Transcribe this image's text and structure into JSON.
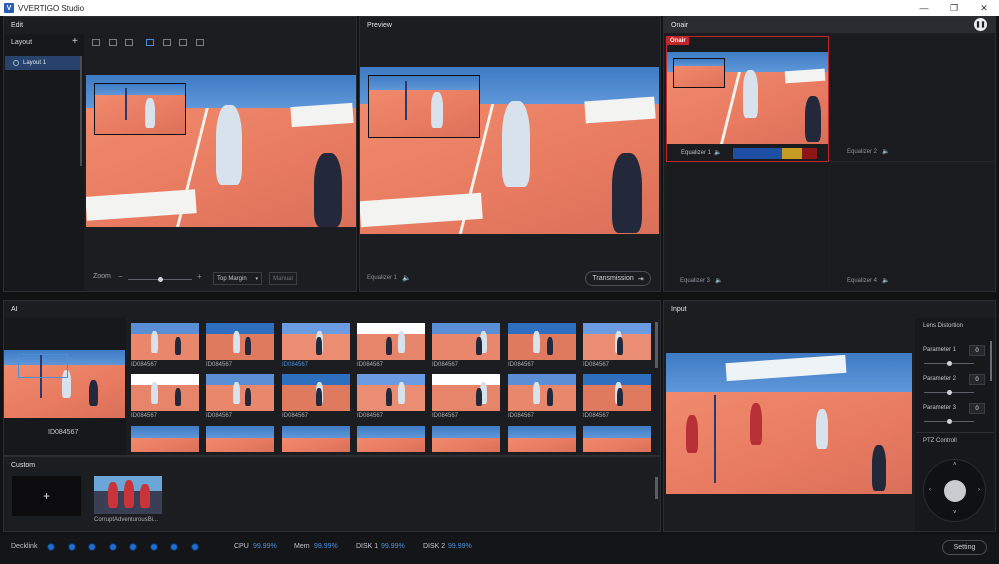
{
  "window": {
    "title": "VVERTIGO Studio",
    "minimize": "—",
    "restore": "❐",
    "close": "✕"
  },
  "edit": {
    "title": "Edit",
    "layout_label": "Layout",
    "add": "+",
    "layouts": [
      "Layout 1"
    ],
    "zoom_label": "Zoom",
    "zoom_minus": "−",
    "zoom_plus": "+",
    "zoom_value": 0.5,
    "margin_select": "Top Margin",
    "manual_button": "Manual"
  },
  "preview": {
    "title": "Preview",
    "equalizer": "Equalizer 1",
    "transmission_button": "Transmission"
  },
  "onair": {
    "title": "Onair",
    "badge": "Onair",
    "pause_icon": "pause-icon",
    "equalizers": [
      "Equalizer 1",
      "Equalizer 2",
      "Equalizer 3",
      "Equalizer 4"
    ],
    "level_colors": [
      "#1e4fa3",
      "#c59b24",
      "#8f1616"
    ]
  },
  "ai": {
    "title": "AI",
    "selected_id": "ID084567",
    "thumb_rows": [
      [
        "ID084567",
        "ID084567",
        "ID084567",
        "ID084567",
        "ID084567",
        "ID084567",
        "ID084567"
      ],
      [
        "ID084567",
        "ID084567",
        "ID084567",
        "ID084567",
        "ID084567",
        "ID084567",
        "ID084567"
      ]
    ]
  },
  "custom": {
    "title": "Custom",
    "add": "+",
    "clips": [
      "CorruptAdventurousBi..."
    ]
  },
  "input": {
    "title": "Input",
    "lens_title": "Lens Distortion",
    "params": [
      {
        "label": "Parameter 1",
        "value": "0",
        "level": 0.5
      },
      {
        "label": "Parameter 2",
        "value": "0",
        "level": 0.5
      },
      {
        "label": "Parameter 3",
        "value": "0",
        "level": 0.5
      }
    ],
    "ptz_title": "PTZ Controll"
  },
  "status": {
    "decklink_label": "Decklink",
    "decklink_count": 8,
    "cpu_label": "CPU",
    "cpu_value": "99.99%",
    "mem_label": "Mem",
    "mem_value": "99.99%",
    "disk1_label": "DISK 1",
    "disk1_value": "99.99%",
    "disk2_label": "DISK 2",
    "disk2_value": "99.99%",
    "setting_button": "Setting",
    "accent": "#4a90d9"
  }
}
